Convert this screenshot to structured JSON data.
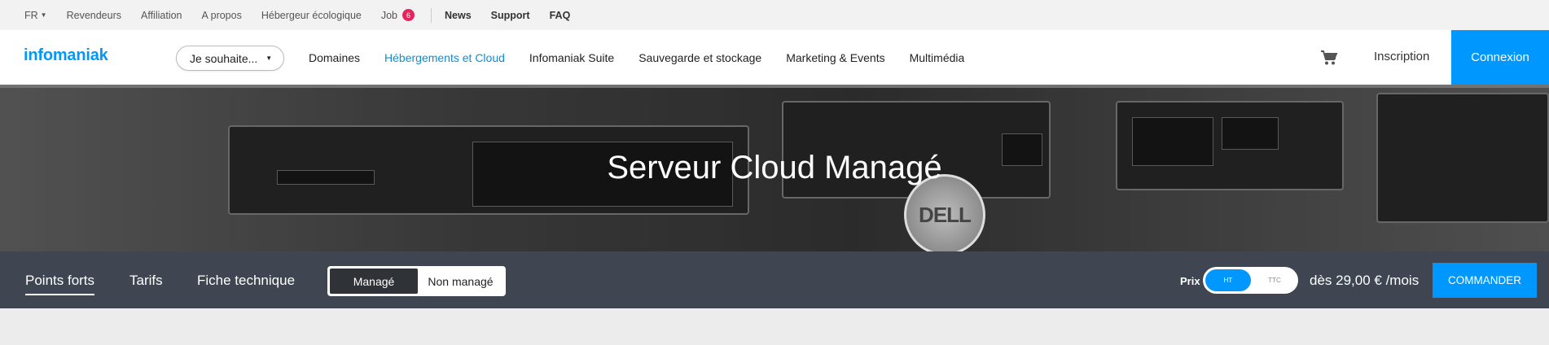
{
  "topbar": {
    "lang": "FR",
    "items": [
      "Revendeurs",
      "Affiliation",
      "A propos",
      "Hébergeur écologique"
    ],
    "job_label": "Job",
    "job_count": "6",
    "right_links": [
      "News",
      "Support",
      "FAQ"
    ]
  },
  "nav": {
    "logo": "infomaniak",
    "want_label": "Je souhaite...",
    "menu": [
      "Domaines",
      "Hébergements et Cloud",
      "Infomaniak Suite",
      "Sauvegarde et stockage",
      "Marketing & Events",
      "Multimédia"
    ],
    "active_menu": "Hébergements et Cloud",
    "signup": "Inscription",
    "login": "Connexion"
  },
  "hero": {
    "title": "Serveur Cloud Managé",
    "brand_mark": "DELL"
  },
  "subnav": {
    "tabs": [
      "Points forts",
      "Tarifs",
      "Fiche technique"
    ],
    "active_tab": "Points forts",
    "segment": {
      "selected": "Managé",
      "other": "Non managé"
    },
    "price_label": "Prix",
    "toggle": {
      "on": "HT",
      "off": "TTC"
    },
    "price": "dès 29,00 € /mois",
    "order": "COMMANDER"
  },
  "colors": {
    "brand": "#0098ff",
    "badge": "#e8245e",
    "subnav_bg": "#3f4652"
  },
  "icons": [
    "caret-down-icon",
    "cart-icon"
  ]
}
